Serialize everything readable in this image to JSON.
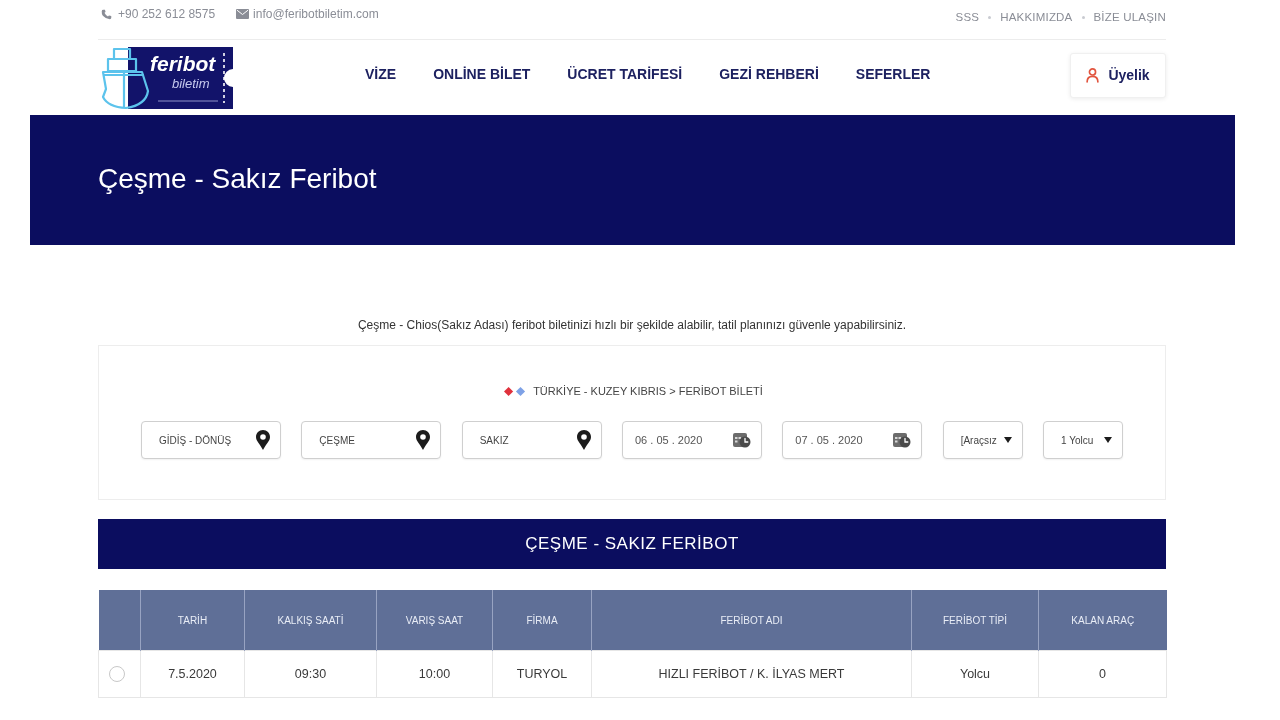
{
  "top_bar": {
    "phone": "+90 252 612 8575",
    "email": "info@feribotbiletim.com",
    "links": [
      "SSS",
      "HAKKIMIZDA",
      "BİZE ULAŞIN"
    ]
  },
  "header": {
    "logo": {
      "title": "feribot",
      "subtitle": "biletim"
    },
    "nav": [
      "VİZE",
      "ONLİNE BİLET",
      "ÜCRET TARİFESİ",
      "GEZİ REHBERİ",
      "SEFERLER"
    ],
    "account_button": "Üyelik"
  },
  "hero": {
    "title": "Çeşme - Sakız Feribot"
  },
  "intro": "Çeşme - Chios(Sakız Adası) feribot biletinizi hızlı bir şekilde alabilir, tatil planınızı güvenle yapabilirsiniz.",
  "search": {
    "breadcrumb": "TÜRKİYE - KUZEY KIBRIS > FERİBOT BİLETİ",
    "fields": [
      {
        "kind": "location",
        "value": "GİDİŞ - DÖNÜŞ"
      },
      {
        "kind": "location",
        "value": "ÇEŞME"
      },
      {
        "kind": "location",
        "value": "SAKIZ"
      },
      {
        "kind": "date",
        "value": "06 . 05 . 2020"
      },
      {
        "kind": "date",
        "value": "07 . 05 . 2020"
      },
      {
        "kind": "dropdown",
        "value": "[Araçsız"
      },
      {
        "kind": "dropdown",
        "value": "1 Yolcu"
      }
    ]
  },
  "results": {
    "title": "ÇEŞME - SAKIZ FERİBOT",
    "columns": [
      "TARİH",
      "KALKIŞ SAATİ",
      "VARIŞ SAAT",
      "FİRMA",
      "FERİBOT ADI",
      "FERİBOT TİPİ",
      "KALAN ARAÇ"
    ],
    "rows": [
      {
        "selected": false,
        "cells": [
          "7.5.2020",
          "09:30",
          "10:00",
          "TURYOL",
          "HIZLI FERİBOT / K. İLYAS MERT",
          "Yolcu",
          "0"
        ]
      }
    ]
  }
}
